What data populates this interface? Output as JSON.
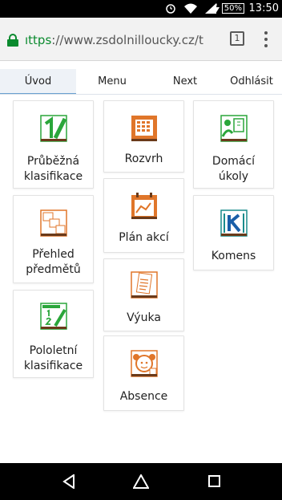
{
  "status": {
    "battery": "50%",
    "time": "13:50"
  },
  "browser": {
    "url_scheme": "https",
    "url_rest": "://www.zsdolnilloucky.cz/t",
    "url_display_prefix": "ıttps",
    "tab_count": "1"
  },
  "nav": {
    "items": [
      {
        "label": "Úvod"
      },
      {
        "label": "Menu"
      },
      {
        "label": "Next"
      },
      {
        "label": "Odhlásit"
      }
    ]
  },
  "tiles": {
    "prubezna": {
      "line1": "Průběžná",
      "line2": "klasifikace"
    },
    "rozvrh": {
      "line1": "Rozvrh"
    },
    "domaci": {
      "line1": "Domácí",
      "line2": "úkoly"
    },
    "prehled": {
      "line1": "Přehled",
      "line2": "předmětů"
    },
    "plan": {
      "line1": "Plán akcí"
    },
    "komens": {
      "line1": "Komens"
    },
    "vyuka": {
      "line1": "Výuka"
    },
    "pololetni": {
      "line1": "Pololetní",
      "line2": "klasifikace"
    },
    "absence": {
      "line1": "Absence"
    }
  },
  "icons": {
    "prubezna": "grade-one-icon",
    "rozvrh": "timetable-icon",
    "domaci": "homework-icon",
    "prehled": "subjects-overview-icon",
    "plan": "calendar-plan-icon",
    "komens": "komens-k-icon",
    "vyuka": "lesson-notes-icon",
    "pololetni": "certificate-icon",
    "absence": "absence-child-icon"
  },
  "colors": {
    "green": "#2aa63a",
    "orange": "#e0762a",
    "teal": "#1a8c8c",
    "accent_blue": "#6aa0d0",
    "lock_green": "#0a8a2e"
  }
}
